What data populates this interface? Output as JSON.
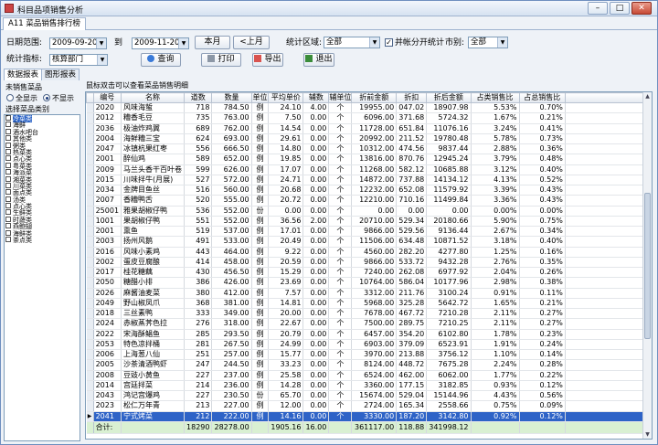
{
  "window": {
    "title": "科目品项销售分析",
    "doc_tab": "A11 菜品销售排行榜",
    "controls": {
      "minimize": "–",
      "maximize": "□",
      "close": "✕"
    }
  },
  "filters": {
    "date_range_label": "日期范围:",
    "date_from": "2009-09-20",
    "to_label": "到",
    "date_to": "2009-11-20",
    "this_month_button": "本月",
    "prev_month_button": "上月",
    "stat_region_label": "统计区域:",
    "stat_region_value": "全部",
    "split_stats_label": "并帐分开统计",
    "split_stats_checked": true,
    "market_label": "市别:",
    "market_value": "全部",
    "stat_metric_label": "统计指标:",
    "stat_metric_value": "核算部门"
  },
  "toolbar": {
    "query_button": "查询",
    "print_button": "打印",
    "export_button": "导出",
    "exit_button": "退出"
  },
  "subtabs": [
    "数据报表",
    "图形报表"
  ],
  "left_panel": {
    "unsold_label": "未销售菜品",
    "show_all_label": "全显示",
    "hide_label": "不显示",
    "hide_selected": true,
    "category_label": "选择菜品类别",
    "categories": [
      {
        "name": "冷菜类",
        "checked": true
      },
      {
        "name": "海鲜",
        "checked": false
      },
      {
        "name": "酒水吧台",
        "checked": false
      },
      {
        "name": "其他类",
        "checked": false
      },
      {
        "name": "粥类",
        "checked": false
      },
      {
        "name": "热菜类",
        "checked": false
      },
      {
        "name": "点心类",
        "checked": false
      },
      {
        "name": "粤菜类",
        "checked": false
      },
      {
        "name": "海派菜",
        "checked": false
      },
      {
        "name": "湘菜类",
        "checked": false
      },
      {
        "name": "川菜类",
        "checked": false
      },
      {
        "name": "面点类",
        "checked": false
      },
      {
        "name": "汤类",
        "checked": false
      },
      {
        "name": "点心类",
        "checked": false
      },
      {
        "name": "生鲜类",
        "checked": false
      },
      {
        "name": "时蔬类",
        "checked": false
      },
      {
        "name": "燕鲍翅",
        "checked": false
      },
      {
        "name": "海鲜类",
        "checked": false
      },
      {
        "name": "茶点类",
        "checked": false
      }
    ]
  },
  "hint": "鼠标双击可以查看菜品销售明细",
  "table": {
    "headers": [
      "编号",
      "名称",
      "道数",
      "数量",
      "单位",
      "平均单价",
      "辅数",
      "辅单位",
      "折前金额",
      "折扣",
      "折后金额",
      "占类销售比",
      "占总销售比"
    ],
    "rows": [
      [
        "2020",
        "风味海蜇",
        "718",
        "784.50",
        "例",
        "24.10",
        "4.00",
        "个",
        "19955.00",
        "047.02",
        "18907.98",
        "5.53%",
        "0.70%"
      ],
      [
        "2012",
        "糟香毛豆",
        "735",
        "763.00",
        "例",
        "7.50",
        "0.00",
        "个",
        "6096.00",
        "371.68",
        "5724.32",
        "1.67%",
        "0.21%"
      ],
      [
        "2036",
        "极油炸鸡翼",
        "689",
        "762.00",
        "例",
        "14.54",
        "0.00",
        "个",
        "11728.00",
        "651.84",
        "11076.16",
        "3.24%",
        "0.41%"
      ],
      [
        "2004",
        "海鲜糟三宝",
        "624",
        "693.00",
        "例",
        "29.61",
        "0.00",
        "个",
        "20992.00",
        "211.52",
        "19780.48",
        "5.78%",
        "0.73%"
      ],
      [
        "2047",
        "冰镇杭果红枣",
        "556",
        "666.50",
        "例",
        "14.80",
        "0.00",
        "个",
        "10312.00",
        "474.56",
        "9837.44",
        "2.88%",
        "0.36%"
      ],
      [
        "2001",
        "醉仙鸡",
        "589",
        "652.00",
        "例",
        "19.85",
        "0.00",
        "个",
        "13816.00",
        "870.76",
        "12945.24",
        "3.79%",
        "0.48%"
      ],
      [
        "2009",
        "马兰头香干百叶卷",
        "599",
        "626.00",
        "例",
        "17.07",
        "0.00",
        "个",
        "11268.00",
        "582.12",
        "10685.88",
        "3.12%",
        "0.40%"
      ],
      [
        "2015",
        "川味拌牛(月展)",
        "527",
        "572.00",
        "例",
        "24.71",
        "0.00",
        "个",
        "14872.00",
        "737.88",
        "14134.12",
        "4.13%",
        "0.52%"
      ],
      [
        "2034",
        "金牌目鱼丝",
        "516",
        "560.00",
        "例",
        "20.68",
        "0.00",
        "个",
        "12232.00",
        "652.08",
        "11579.92",
        "3.39%",
        "0.43%"
      ],
      [
        "2007",
        "香糟鸭舌",
        "520",
        "555.00",
        "例",
        "20.72",
        "0.00",
        "个",
        "12210.00",
        "710.16",
        "11499.84",
        "3.36%",
        "0.43%"
      ],
      [
        "25001",
        "雅果胡椒仔鸭",
        "536",
        "552.00",
        "份",
        "0.00",
        "0.00",
        "个",
        "0.00",
        "0.00",
        "0.00",
        "0.00%",
        "0.00%"
      ],
      [
        "1001",
        "果胡椒仔鸭",
        "551",
        "552.00",
        "例",
        "36.56",
        "2.00",
        "个",
        "20710.00",
        "529.34",
        "20180.66",
        "5.90%",
        "0.75%"
      ],
      [
        "2001",
        "熏鱼",
        "519",
        "537.00",
        "例",
        "17.01",
        "0.00",
        "个",
        "9866.00",
        "529.56",
        "9136.44",
        "2.67%",
        "0.34%"
      ],
      [
        "2003",
        "扬州风鹅",
        "491",
        "533.00",
        "例",
        "20.49",
        "0.00",
        "个",
        "11506.00",
        "634.48",
        "10871.52",
        "3.18%",
        "0.40%"
      ],
      [
        "2016",
        "风味小素鸡",
        "443",
        "464.00",
        "例",
        "9.22",
        "0.00",
        "个",
        "4560.00",
        "282.20",
        "4277.80",
        "1.25%",
        "0.16%"
      ],
      [
        "2002",
        "蛋皮豆腐酿",
        "414",
        "458.00",
        "例",
        "20.59",
        "0.00",
        "个",
        "9866.00",
        "533.72",
        "9432.28",
        "2.76%",
        "0.35%"
      ],
      [
        "2017",
        "桂花糖藕",
        "430",
        "456.50",
        "例",
        "15.29",
        "0.00",
        "个",
        "7240.00",
        "262.08",
        "6977.92",
        "2.04%",
        "0.26%"
      ],
      [
        "2050",
        "糖醋小排",
        "386",
        "426.00",
        "例",
        "23.69",
        "0.00",
        "个",
        "10764.00",
        "586.04",
        "10177.96",
        "2.98%",
        "0.38%"
      ],
      [
        "2026",
        "麻酱油麦菜",
        "380",
        "412.00",
        "例",
        "7.57",
        "0.00",
        "个",
        "3312.00",
        "211.76",
        "3100.24",
        "0.91%",
        "0.11%"
      ],
      [
        "2049",
        "野山椒凤爪",
        "368",
        "381.00",
        "例",
        "14.81",
        "0.00",
        "个",
        "5968.00",
        "325.28",
        "5642.72",
        "1.65%",
        "0.21%"
      ],
      [
        "2018",
        "三丝素鸭",
        "333",
        "349.00",
        "例",
        "20.00",
        "0.00",
        "个",
        "7678.00",
        "467.72",
        "7210.28",
        "2.11%",
        "0.27%"
      ],
      [
        "2024",
        "赤椒蒸荠色拉",
        "276",
        "318.00",
        "例",
        "22.67",
        "0.00",
        "个",
        "7500.00",
        "289.75",
        "7210.25",
        "2.11%",
        "0.27%"
      ],
      [
        "2022",
        "宋海酥鲳鱼",
        "285",
        "293.50",
        "例",
        "20.79",
        "0.00",
        "个",
        "6457.00",
        "354.20",
        "6102.80",
        "1.78%",
        "0.23%"
      ],
      [
        "2053",
        "特色凉拌桶",
        "281",
        "267.50",
        "例",
        "24.99",
        "0.00",
        "个",
        "6903.00",
        "379.09",
        "6523.91",
        "1.91%",
        "0.24%"
      ],
      [
        "2006",
        "上海葱八仙",
        "251",
        "257.00",
        "例",
        "15.77",
        "0.00",
        "个",
        "3970.00",
        "213.88",
        "3756.12",
        "1.10%",
        "0.14%"
      ],
      [
        "2005",
        "沙茶清酒鸭虾",
        "247",
        "244.50",
        "例",
        "33.23",
        "0.00",
        "个",
        "8124.00",
        "448.72",
        "7675.28",
        "2.24%",
        "0.28%"
      ],
      [
        "2008",
        "豆豉小黄鱼",
        "227",
        "237.00",
        "例",
        "25.58",
        "0.00",
        "个",
        "6524.00",
        "462.00",
        "6062.00",
        "1.77%",
        "0.22%"
      ],
      [
        "2014",
        "宫廷拌菜",
        "214",
        "236.00",
        "例",
        "14.28",
        "0.00",
        "个",
        "3360.00",
        "177.15",
        "3182.85",
        "0.93%",
        "0.12%"
      ],
      [
        "2043",
        "鸿记宫爆鸡",
        "227",
        "230.50",
        "份",
        "65.70",
        "0.00",
        "个",
        "15674.00",
        "529.04",
        "15144.96",
        "4.43%",
        "0.56%"
      ],
      [
        "2023",
        "松仁万年青",
        "213",
        "227.00",
        "例",
        "12.00",
        "0.00",
        "个",
        "2724.00",
        "165.34",
        "2558.66",
        "0.75%",
        "0.09%"
      ],
      [
        "2041",
        "宁式烤菜",
        "212",
        "222.00",
        "例",
        "14.16",
        "0.00",
        "个",
        "3330.00",
        "187.20",
        "3142.80",
        "0.92%",
        "0.12%"
      ]
    ],
    "selected_row": 30,
    "total": {
      "label": "合计:",
      "count": "18290",
      "quantity": "28278.00",
      "avg_price": "1905.16",
      "aux": "16.00",
      "pre_discount": "361117.00",
      "discount": "118.88",
      "post_discount": "341998.12"
    }
  }
}
